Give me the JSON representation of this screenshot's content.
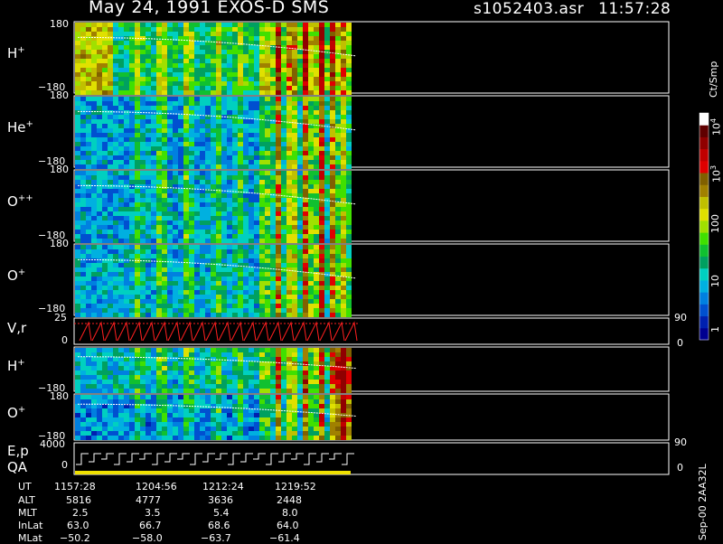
{
  "header": {
    "title": "May 24, 1991    EXOS-D SMS",
    "file": "s1052403.asr",
    "time": "11:57:28"
  },
  "panels": [
    {
      "id": "h-plus",
      "label": "H",
      "sup": "+",
      "top_tick": "180",
      "bottom_tick": "−180"
    },
    {
      "id": "he-plus",
      "label": "He",
      "sup": "+",
      "top_tick": "180",
      "bottom_tick": "−180"
    },
    {
      "id": "o-plus-plus",
      "label": "O",
      "sup": "++",
      "top_tick": "180",
      "bottom_tick": "−180"
    },
    {
      "id": "o-plus",
      "label": "O",
      "sup": "+",
      "top_tick": "180",
      "bottom_tick": "−180"
    },
    {
      "id": "vr",
      "label": "V,r",
      "sup": "",
      "top_tick": "25",
      "bottom_tick": "0",
      "right_top": "90",
      "right_bottom": "0"
    },
    {
      "id": "h-plus-2",
      "label": "H",
      "sup": "+",
      "top_tick": "",
      "bottom_tick": "−180"
    },
    {
      "id": "o-plus-2",
      "label": "O",
      "sup": "+",
      "top_tick": "180",
      "bottom_tick": "−180"
    },
    {
      "id": "ep",
      "label": "E,p",
      "sup": "",
      "label2": "QA",
      "top_tick": "4000",
      "bottom_tick": "0",
      "right_top": "90",
      "right_bottom": "0"
    }
  ],
  "colorbar": {
    "unit": "Ct/Smp",
    "ticks": [
      {
        "base": "10",
        "exp": "4"
      },
      {
        "base": "10",
        "exp": "3"
      },
      {
        "base": "100",
        "exp": ""
      },
      {
        "base": "10",
        "exp": ""
      },
      {
        "base": "1",
        "exp": ""
      }
    ],
    "colors": [
      "#000090",
      "#0020b0",
      "#0050d0",
      "#0080e0",
      "#00b0e0",
      "#00d0c0",
      "#00a060",
      "#10c030",
      "#40e000",
      "#a0e000",
      "#e0e000",
      "#c0c000",
      "#a08000",
      "#806000",
      "#e00000",
      "#c00000",
      "#900000",
      "#600000",
      "#ffffff"
    ]
  },
  "ephemeris": {
    "rows": [
      {
        "label": "UT",
        "values": [
          "1157:28",
          "1204:56",
          "1212:24",
          "1219:52"
        ]
      },
      {
        "label": "ALT",
        "values": [
          "5816",
          "4777",
          "3636",
          "2448"
        ]
      },
      {
        "label": "MLT",
        "values": [
          "2.5",
          "3.5",
          "5.4",
          "8.0"
        ]
      },
      {
        "label": "InLat",
        "values": [
          "63.0",
          "66.7",
          "68.6",
          "64.0"
        ]
      },
      {
        "label": "MLat",
        "values": [
          "−50.2",
          "−58.0",
          "−63.7",
          "−61.4"
        ]
      }
    ]
  },
  "footer_vertical": "Sep-00  2AA32L",
  "chart_data": {
    "type": "heatmap",
    "title": "May 24, 1991    EXOS-D SMS",
    "xlabel": "UT",
    "x_ticks": [
      "1157:28",
      "1204:56",
      "1212:24",
      "1219:52"
    ],
    "panels": [
      "H+",
      "He+",
      "O++",
      "O+",
      "V,r",
      "H+",
      "O+",
      "E,p QA"
    ],
    "ylim_pitch": [
      -180,
      180
    ],
    "colorbar": {
      "unit": "Ct/Smp",
      "scale": "log",
      "range": [
        1,
        10000
      ]
    }
  }
}
